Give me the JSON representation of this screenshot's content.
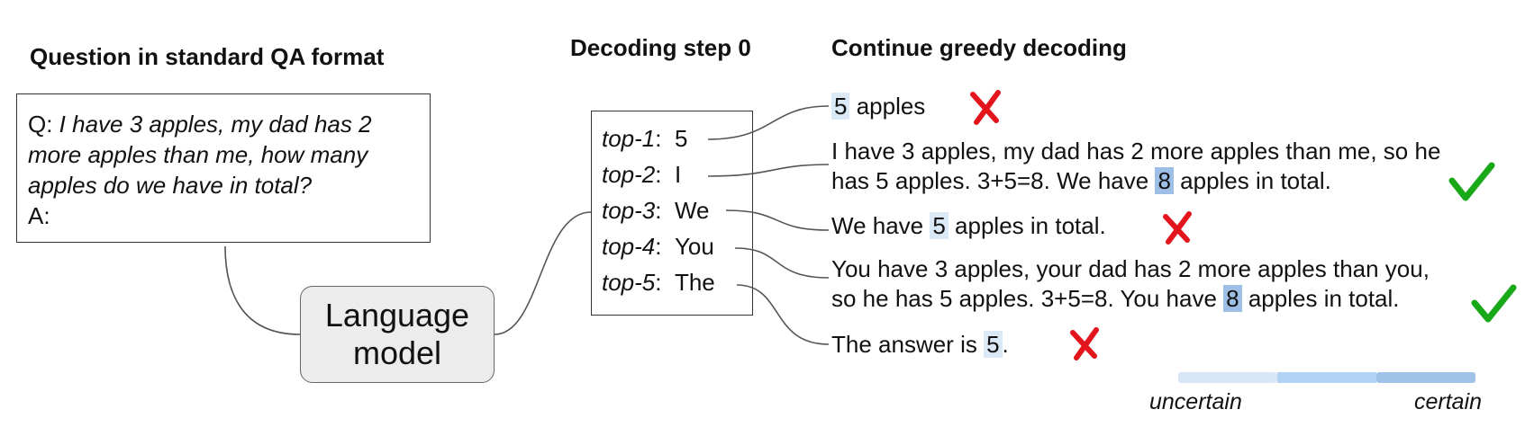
{
  "headings": {
    "question": "Question in standard QA format",
    "decoding_step": "Decoding step 0",
    "continue": "Continue greedy decoding"
  },
  "question_box": {
    "q_prefix": "Q: ",
    "q_line1": "I have 3 apples, my dad has 2",
    "q_line2": "more apples than me, how many",
    "q_line3": "apples do we have in total?",
    "a_prefix": "A:"
  },
  "language_model": {
    "line1": "Language",
    "line2": "model"
  },
  "top_tokens": [
    {
      "rank": "top-1",
      "sep": ":",
      "token": "5"
    },
    {
      "rank": "top-2",
      "sep": ":",
      "token": "I"
    },
    {
      "rank": "top-3",
      "sep": ":",
      "token": "We"
    },
    {
      "rank": "top-4",
      "sep": ":",
      "token": "You"
    },
    {
      "rank": "top-5",
      "sep": ":",
      "token": "The"
    }
  ],
  "continuations": [
    {
      "pre": "",
      "hl": "5",
      "post": " apples",
      "correct": false
    },
    {
      "line1": "I have 3 apples, my dad has 2 more apples than me, so he",
      "pre": "has 5 apples. 3+5=8. We have ",
      "hl": "8",
      "post": " apples in total.",
      "correct": true
    },
    {
      "pre": "We have ",
      "hl": "5",
      "post": " apples in total.",
      "correct": false
    },
    {
      "line1": "You have 3 apples, your dad has 2 more apples than you,",
      "pre": "so he has 5 apples. 3+5=8. You have ",
      "hl": "8",
      "post": " apples in total.",
      "correct": true
    },
    {
      "pre": "The answer is ",
      "hl": "5",
      "post": ".",
      "correct": false
    }
  ],
  "legend": {
    "low": "uncertain",
    "high": "certain",
    "colors": [
      "#d6e6f7",
      "#b3d3f4",
      "#9fc2e8"
    ]
  },
  "colors": {
    "cross": "#e3141b",
    "check": "#18a818",
    "hl_light": "#dbe8f6",
    "hl_dark": "#9dbfe6"
  }
}
